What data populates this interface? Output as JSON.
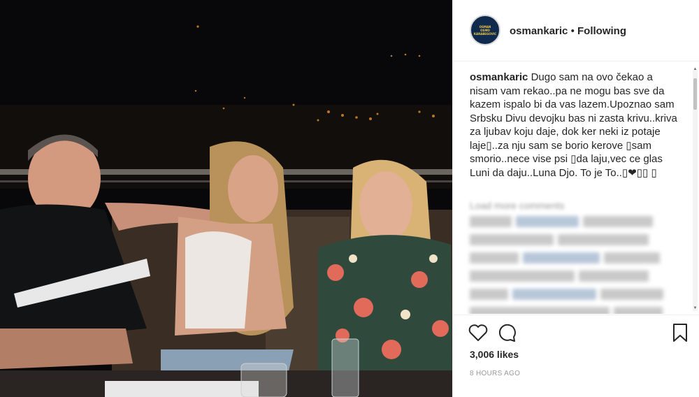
{
  "post": {
    "header": {
      "avatar_text": [
        "OSMAN",
        "OSMO",
        "KARABEGOVIC"
      ],
      "username": "osmankaric",
      "separator": "•",
      "follow_status": "Following"
    },
    "caption": {
      "username": "osmankaric",
      "text": "Dugo sam na ovo čekao a nisam vam rekao..pa ne mogu bas sve da kazem ispalo bi da vas lazem.Upoznao sam Srbsku Divu devojku bas ni zasta krivu..kriva za ljubav koju daje, dok ker neki iz potaje laje▯..za nju sam se borio kerove ▯sam smorio..nece vise psi ▯da laju,vec ce glas Luni da daju..Luna Djo. To je To..▯❤▯▯ ▯"
    },
    "load_more": "Load more comments",
    "likes": "3,006 likes",
    "timestamp": "8 HOURS AGO",
    "icons": [
      "heart-icon",
      "comment-icon",
      "bookmark-icon"
    ]
  },
  "colors": {
    "text": "#262626",
    "muted": "#999999",
    "border": "#efefef"
  }
}
